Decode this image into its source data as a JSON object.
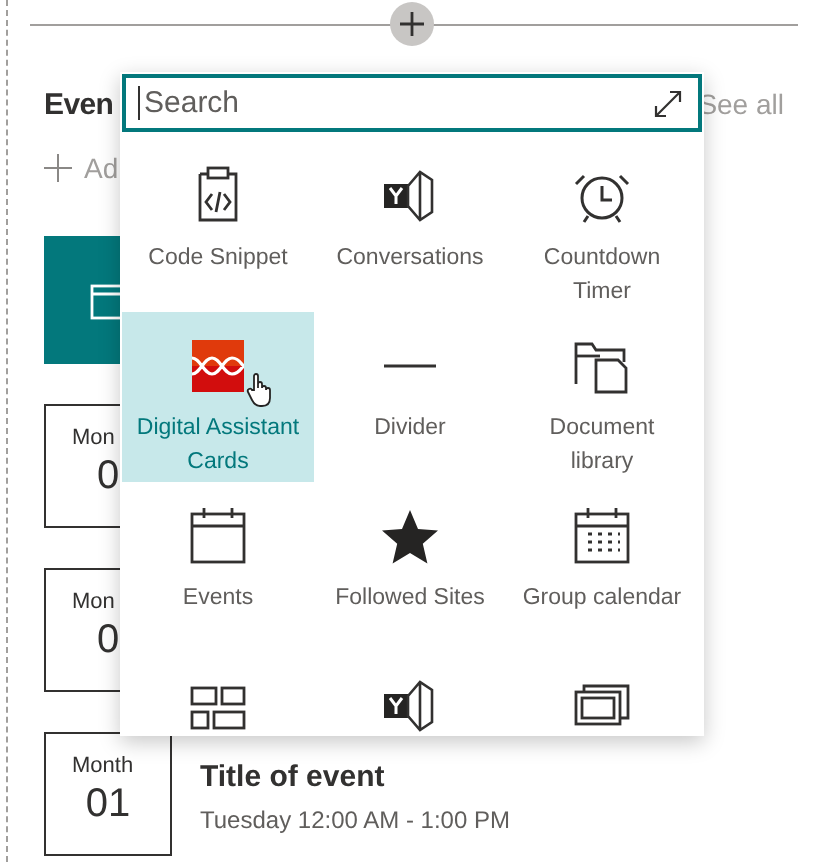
{
  "section": {
    "title": "Even",
    "see_all": "See all",
    "add": "Ad"
  },
  "events": [
    {
      "month": "Mon",
      "day": "0"
    },
    {
      "month": "Mon",
      "day": "0"
    },
    {
      "month": "Month",
      "day": "01",
      "title": "Title of event",
      "time": "Tuesday 12:00 AM - 1:00 PM"
    }
  ],
  "picker": {
    "search": {
      "placeholder": "Search"
    },
    "tiles": [
      {
        "label": "Code Snippet",
        "selected": false
      },
      {
        "label": "Conversations",
        "selected": false
      },
      {
        "label": "Countdown Timer",
        "selected": false
      },
      {
        "label": "Digital Assistant Cards",
        "selected": true
      },
      {
        "label": "Divider",
        "selected": false
      },
      {
        "label": "Document library",
        "selected": false
      },
      {
        "label": "Events",
        "selected": false
      },
      {
        "label": "Followed Sites",
        "selected": false
      },
      {
        "label": "Group calendar",
        "selected": false
      },
      {
        "selected": false
      },
      {
        "selected": false
      },
      {
        "selected": false
      }
    ]
  }
}
